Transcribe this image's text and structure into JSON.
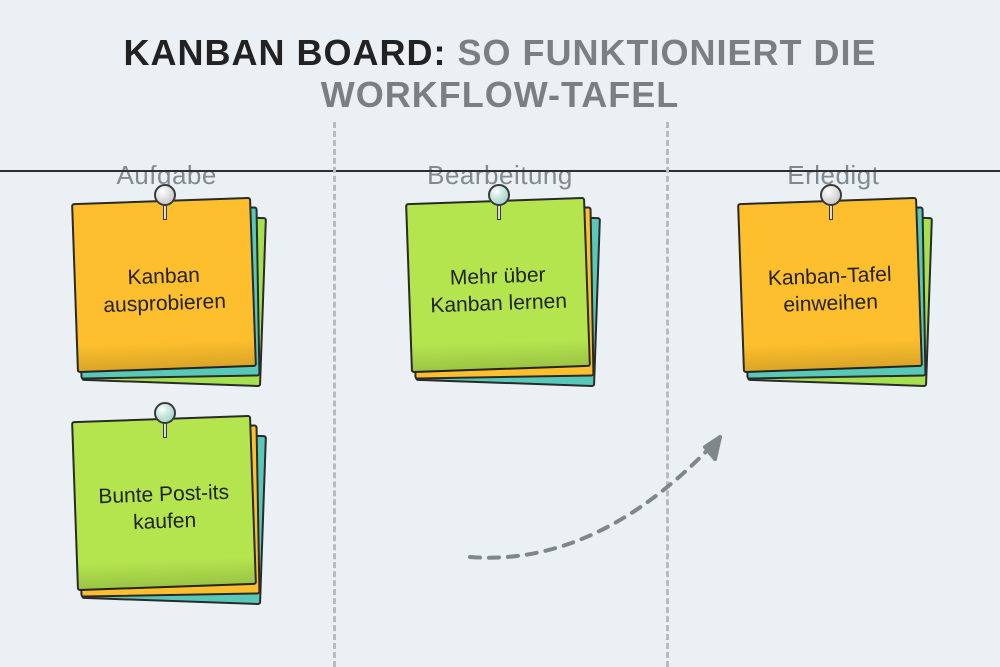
{
  "heading": {
    "bold": "KANBAN BOARD:",
    "rest": " SO FUNKTIONIERT DIE WORKFLOW-TAFEL"
  },
  "columns": [
    {
      "label": "Aufgabe"
    },
    {
      "label": "Bearbeitung"
    },
    {
      "label": "Erledigt"
    }
  ],
  "notes": {
    "s1": {
      "text": "Kanban ausprobieren",
      "color": "yellow",
      "pin": "grey"
    },
    "s2": {
      "text": "Bunte Post-its kaufen",
      "color": "green",
      "pin": "teal"
    },
    "s3": {
      "text": "Mehr über Kanban lernen",
      "color": "green",
      "pin": "teal"
    },
    "s4": {
      "text": "Kanban-Tafel einweihen",
      "color": "yellow",
      "pin": "grey"
    }
  }
}
